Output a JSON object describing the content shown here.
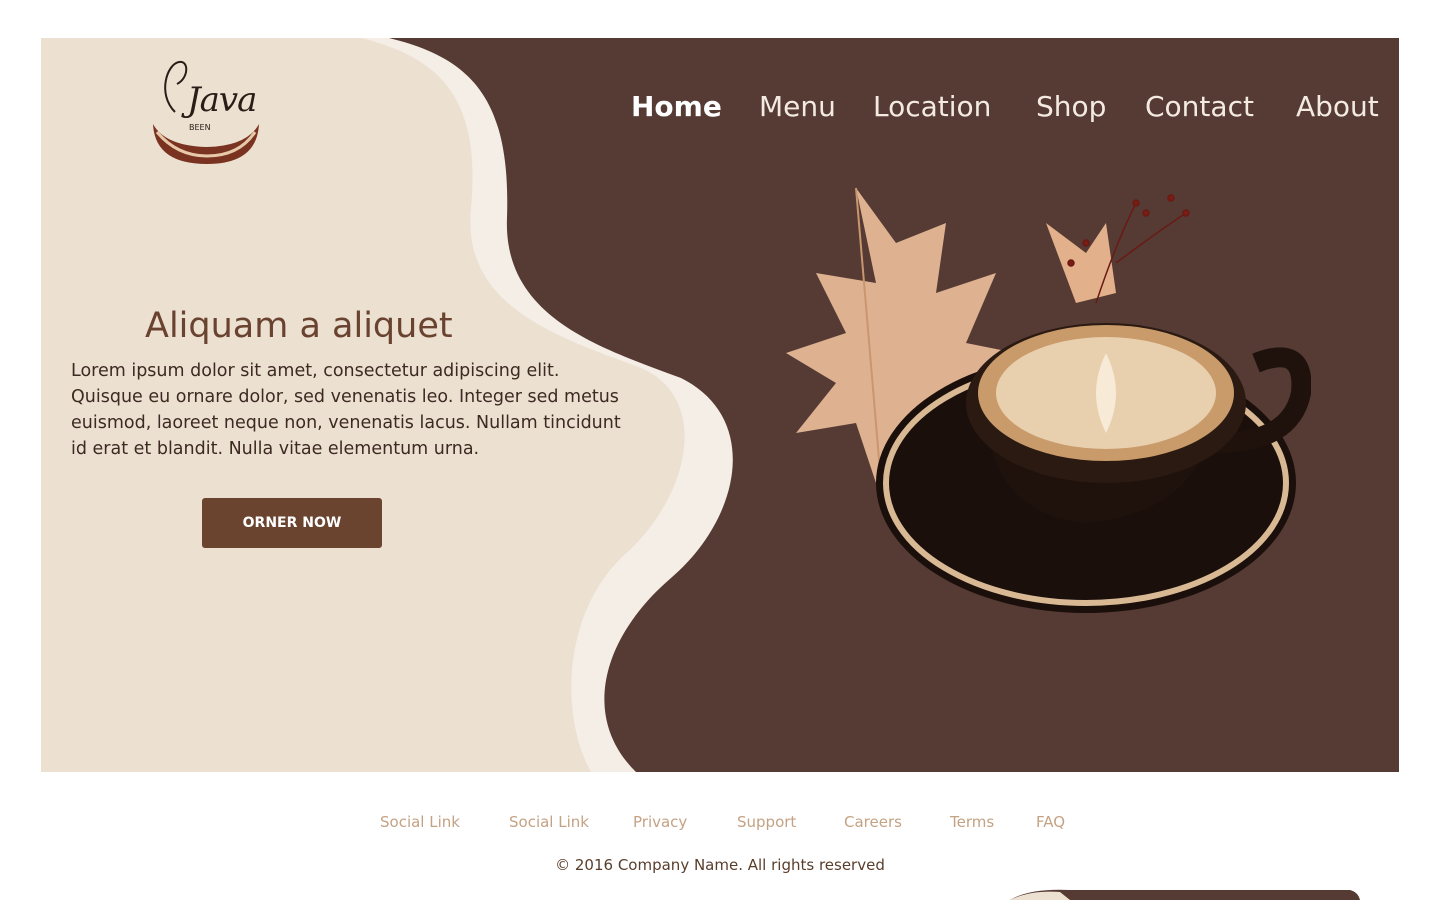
{
  "brand": {
    "logo_word": "Java",
    "logo_sub": "BEEN"
  },
  "nav": {
    "items": [
      {
        "label": "Home",
        "active": true
      },
      {
        "label": "Menu"
      },
      {
        "label": "Location"
      },
      {
        "label": "Shop"
      },
      {
        "label": "Contact"
      },
      {
        "label": "About"
      }
    ]
  },
  "hero": {
    "headline": "Aliquam a aliquet",
    "body": "Lorem ipsum dolor sit amet, consectetur adipiscing elit. Quisque eu ornare dolor, sed venenatis leo. Integer sed metus euismod, laoreet neque non, venenatis lacus. Nullam tincidunt id erat et blandit. Nulla vitae elementum urna.",
    "cta_label": "ORNER NOW"
  },
  "footer": {
    "links": [
      "Social Link",
      "Social Link",
      "Privacy",
      "Support",
      "Careers",
      "Terms",
      "FAQ"
    ],
    "copyright": "© 2016 Company Name. All rights reserved"
  },
  "colors": {
    "hero_dark": "#563a34",
    "hero_light": "#ece0d1",
    "wave_highlight": "#f4eee6",
    "accent_button": "#6b4430",
    "footer_link": "#c4a284"
  }
}
